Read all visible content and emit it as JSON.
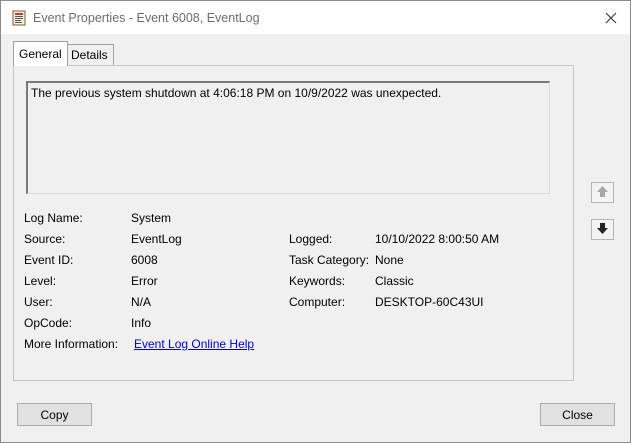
{
  "window": {
    "title": "Event Properties - Event 6008, EventLog"
  },
  "tabs": [
    {
      "label": "General"
    },
    {
      "label": "Details"
    }
  ],
  "description": "The previous system shutdown at 4:06:18 PM on 10/9/2022 was unexpected.",
  "fields": {
    "log_name": {
      "label": "Log Name:",
      "value": "System"
    },
    "source": {
      "label": "Source:",
      "value": "EventLog"
    },
    "event_id": {
      "label": "Event ID:",
      "value": "6008"
    },
    "level": {
      "label": "Level:",
      "value": "Error"
    },
    "user": {
      "label": "User:",
      "value": "N/A"
    },
    "opcode": {
      "label": "OpCode:",
      "value": "Info"
    },
    "more_info": {
      "label": "More Information:",
      "value": "Event Log Online Help"
    },
    "logged": {
      "label": "Logged:",
      "value": "10/10/2022 8:00:50 AM"
    },
    "task_category": {
      "label": "Task Category:",
      "value": "None"
    },
    "keywords": {
      "label": "Keywords:",
      "value": "Classic"
    },
    "computer": {
      "label": "Computer:",
      "value": "DESKTOP-60C43UI"
    }
  },
  "buttons": {
    "copy": "Copy",
    "close": "Close"
  },
  "icons": {
    "title": "event-properties-icon",
    "close": "close-icon",
    "prev": "arrow-up-icon",
    "next": "arrow-down-icon"
  },
  "colors": {
    "link": "#0000cc",
    "window_bg": "#f0f0f0"
  }
}
